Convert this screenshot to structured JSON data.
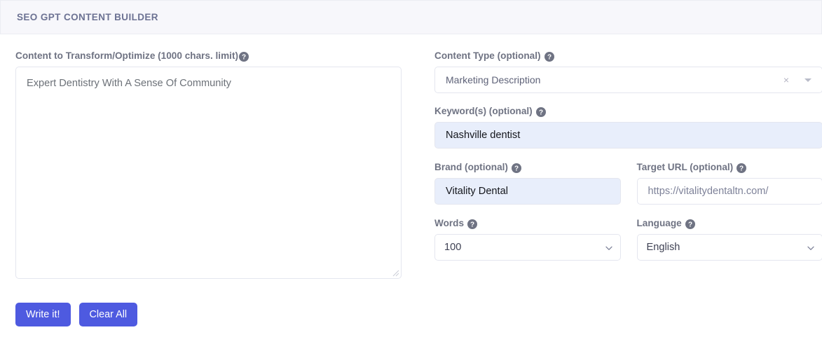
{
  "header": {
    "title": "SEO GPT CONTENT BUILDER"
  },
  "left": {
    "content_label": "Content to Transform/Optimize (1000 chars. limit)",
    "content_help_icon": "help-circle-icon",
    "content_value": "Expert Dentistry With A Sense Of Community",
    "content_placeholder": ""
  },
  "buttons": {
    "write": "Write it!",
    "clear": "Clear All",
    "color": "#4e5ae0"
  },
  "right": {
    "content_type": {
      "label": "Content Type (optional)",
      "help_icon": "help-circle-icon",
      "value": "Marketing Description",
      "clear_icon": "close-icon",
      "caret_icon": "chevron-down-icon"
    },
    "keywords": {
      "label": "Keyword(s) (optional)",
      "help_icon": "help-circle-icon",
      "value": "Nashville dentist",
      "placeholder": ""
    },
    "brand": {
      "label": "Brand (optional)",
      "help_icon": "help-circle-icon",
      "value": "Vitality Dental",
      "placeholder": ""
    },
    "target_url": {
      "label": "Target URL (optional)",
      "help_icon": "help-circle-icon",
      "value": "https://vitalitydentaltn.com/",
      "placeholder": "https://vitalitydentaltn.com/"
    },
    "words": {
      "label": "Words",
      "help_icon": "help-circle-icon",
      "value": "100",
      "options": [
        "100"
      ]
    },
    "language": {
      "label": "Language",
      "help_icon": "help-circle-icon",
      "value": "English",
      "options": [
        "English"
      ]
    }
  },
  "colors": {
    "header_bg": "#f7f7fb",
    "border": "#e4e6ef",
    "autofill_bg": "#e8eefb",
    "accent": "#4e5ae0",
    "label_text": "#6f7383"
  }
}
